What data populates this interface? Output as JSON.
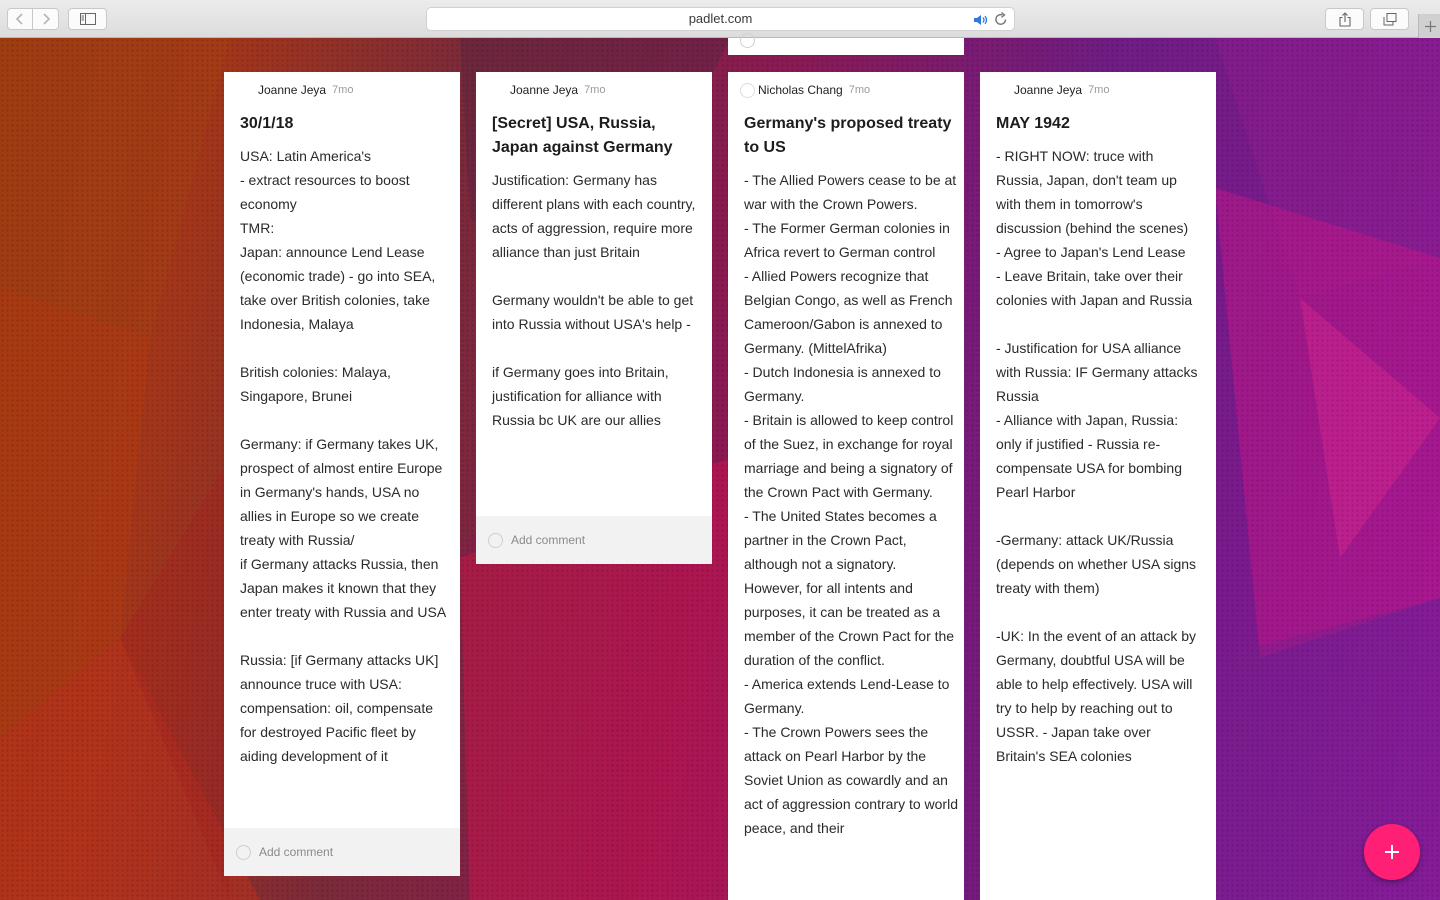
{
  "browser": {
    "url": "padlet.com",
    "icons": {
      "back": "chevron-left-icon",
      "forward": "chevron-right-icon",
      "sidebar": "sidebar-icon",
      "audio": "speaker-icon",
      "reload": "reload-icon",
      "share": "share-icon",
      "tabs": "tabs-overview-icon",
      "new_tab": "plus-icon"
    }
  },
  "board": {
    "comment_placeholder": "Add comment",
    "accent_color": "#ff1f74",
    "add_post_icon": "plus-icon",
    "posts": [
      {
        "author": "Joanne Jeya",
        "time": "7mo",
        "title": "30/1/18",
        "body": [
          "USA: Latin America's",
          "- extract resources to boost economy",
          "TMR:",
          "Japan: announce Lend Lease (economic trade) - go into SEA, take over British colonies, take Indonesia, Malaya",
          "",
          "British colonies: Malaya, Singapore, Brunei",
          "",
          "Germany: if Germany takes UK, prospect of almost entire Europe in Germany's hands, USA no allies in Europe so we create treaty with Russia/",
          "if Germany attacks Russia, then Japan makes it known that they enter treaty with Russia and USA",
          "",
          "Russia: [if Germany attacks UK] announce truce with USA: compensation: oil, compensate for destroyed Pacific fleet by aiding development of it"
        ]
      },
      {
        "author": "Joanne Jeya",
        "time": "7mo",
        "title": "[Secret] USA, Russia, Japan  against Germany",
        "body": [
          "Justification: Germany has different plans with each country, acts of aggression, require more alliance than just Britain",
          "",
          "Germany wouldn't be able to get into Russia without USA's help -",
          "",
          "if Germany goes into Britain, justification for alliance with Russia bc UK are our allies"
        ]
      },
      {
        "author": "Nicholas Chang",
        "time": "7mo",
        "title": "Germany's proposed treaty to US",
        "body": [
          "- The Allied Powers cease to be at war with the Crown Powers.",
          "- The Former German colonies in Africa revert to German control",
          "- Allied Powers recognize that Belgian Congo, as well as French Cameroon/Gabon is annexed to Germany. (MittelAfrika)",
          "- Dutch Indonesia is annexed to Germany.",
          "- Britain is allowed to keep control of the Suez, in exchange for royal marriage and being a signatory of the Crown Pact with Germany.",
          "- The United States becomes a partner in the Crown Pact, although not a signatory. However, for all intents and purposes, it can be treated as a member of the Crown Pact for the duration of the conflict.",
          "- America extends Lend-Lease to Germany.",
          "- The Crown Powers sees the attack on Pearl Harbor by the Soviet Union as cowardly and an act of aggression contrary to world peace, and their"
        ]
      },
      {
        "author": "Joanne Jeya",
        "time": "7mo",
        "title": "MAY 1942",
        "body": [
          "- RIGHT NOW: truce with Russia, Japan, don't team up with them in tomorrow's discussion (behind the scenes)",
          "- Agree to Japan's Lend Lease",
          "- Leave Britain, take over their colonies with Japan and Russia",
          "",
          "- Justification for USA alliance with Russia: IF Germany attacks Russia",
          "- Alliance with Japan, Russia: only if justified - Russia re-compensate USA for bombing Pearl Harbor",
          "",
          "-Germany: attack UK/Russia (depends on whether USA signs treaty with them)",
          "",
          "-UK: In the event of an attack by Germany, doubtful USA will be able to help effectively. USA will try to help by reaching out to USSR. - Japan take over Britain's SEA colonies"
        ]
      }
    ]
  }
}
